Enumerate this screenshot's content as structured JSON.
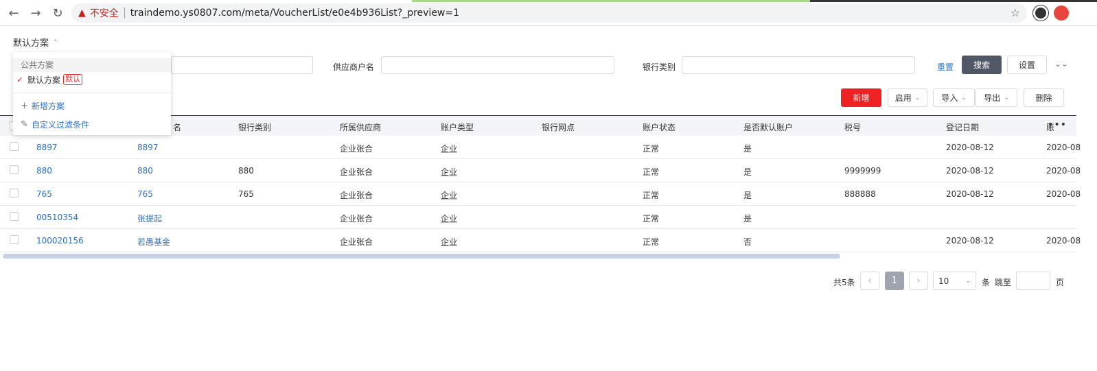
{
  "browser": {
    "insecure_label": "不安全",
    "url": "traindemo.ys0807.com/meta/VoucherList/e0e4b936List?_preview=1"
  },
  "scheme": {
    "current": "默认方案",
    "popup": {
      "group_title": "公共方案",
      "item_label": "默认方案",
      "item_badge": "默认",
      "add_label": "新增方案",
      "custom_label": "自定义过滤条件"
    }
  },
  "filters": {
    "supplier_label": "供应商户名",
    "bank_type_label": "银行类别",
    "reset": "重置",
    "search": "搜索",
    "settings": "设置"
  },
  "toolbar": {
    "add": "新增",
    "enable": "启用",
    "import": "导入",
    "export": "导出",
    "delete": "删除"
  },
  "table": {
    "columns": [
      "名",
      "银行类别",
      "所属供应商",
      "账户类型",
      "银行网点",
      "账户状态",
      "是否默认账户",
      "税号",
      "登记日期",
      "账"
    ],
    "rows": [
      {
        "c0": "8897",
        "c1": "8897",
        "c2": "",
        "c3": "企业张合",
        "c4": "企业",
        "c5": "",
        "c6": "正常",
        "c7": "是",
        "c8": "",
        "c9": "2020-08-12",
        "c10": "2020-08"
      },
      {
        "c0": "880",
        "c1": "880",
        "c2": "880",
        "c3": "企业张合",
        "c4": "企业",
        "c5": "",
        "c6": "正常",
        "c7": "是",
        "c8": "9999999",
        "c9": "2020-08-12",
        "c10": "2020-08"
      },
      {
        "c0": "765",
        "c1": "765",
        "c2": "765",
        "c3": "企业张合",
        "c4": "企业",
        "c5": "",
        "c6": "正常",
        "c7": "是",
        "c8": "888888",
        "c9": "2020-08-12",
        "c10": "2020-08"
      },
      {
        "c0": "00510354",
        "c1": "张提起",
        "c2": "",
        "c3": "企业张合",
        "c4": "企业",
        "c5": "",
        "c6": "正常",
        "c7": "是",
        "c8": "",
        "c9": "",
        "c10": ""
      },
      {
        "c0": "100020156",
        "c1": "若愚基金",
        "c2": "",
        "c3": "企业张合",
        "c4": "企业",
        "c5": "",
        "c6": "正常",
        "c7": "否",
        "c8": "",
        "c9": "2020-08-12",
        "c10": "2020-08"
      }
    ]
  },
  "pagination": {
    "total": "共5条",
    "page": "1",
    "page_size": "10",
    "unit": "条",
    "jump_label": "跳至",
    "page_unit": "页"
  }
}
